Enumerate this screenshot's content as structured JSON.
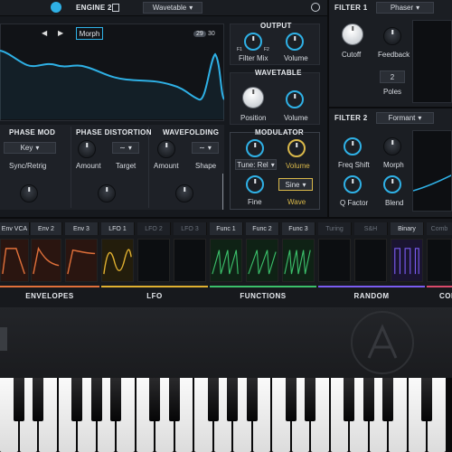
{
  "engine2": {
    "title": "ENGINE 2",
    "mode": "Wavetable"
  },
  "display": {
    "mode_button": "Morph",
    "counter_a": "29",
    "counter_b": "30"
  },
  "output": {
    "title": "OUTPUT",
    "filter_mix": "Filter Mix",
    "f1": "F1",
    "f2": "F2",
    "volume": "Volume"
  },
  "wavetable": {
    "title": "WAVETABLE",
    "position": "Position",
    "volume": "Volume"
  },
  "modulator": {
    "title": "MODULATOR",
    "tune_mode": "Tune: Rel",
    "volume": "Volume",
    "fine": "Fine",
    "wave_shape": "Sine",
    "wave": "Wave"
  },
  "phase_mod": {
    "title": "PHASE MOD",
    "key": "Key",
    "sync": "Sync/Retrig"
  },
  "phase_distortion": {
    "title": "PHASE DISTORTION",
    "amount": "Amount",
    "target": "Target"
  },
  "wavefolding": {
    "title": "WAVEFOLDING",
    "amount": "Amount",
    "shape": "Shape"
  },
  "filter1": {
    "title": "FILTER 1",
    "type": "Phaser",
    "cutoff": "Cutoff",
    "feedback": "Feedback",
    "poles_value": "2",
    "poles": "Poles"
  },
  "filter2": {
    "title": "FILTER 2",
    "type": "Formant",
    "freq_shift": "Freq Shift",
    "morph": "Morph",
    "q_factor": "Q Factor",
    "blend": "Blend"
  },
  "mod_tabs": [
    "Env VCA",
    "Env 2",
    "Env 3",
    "LFO 1",
    "LFO 2",
    "LFO 3",
    "Func 1",
    "Func 2",
    "Func 3",
    "Turing",
    "S&H",
    "Binary",
    "Comb"
  ],
  "sections": [
    "ENVELOPES",
    "LFO",
    "FUNCTIONS",
    "RANDOM",
    "COM"
  ],
  "colors": {
    "accent": "#2fb1e6",
    "envelope": "#e0703a",
    "lfo": "#e0b030",
    "function": "#3bbf6a",
    "random": "#7a5cf0",
    "panel": "#1e2127"
  }
}
